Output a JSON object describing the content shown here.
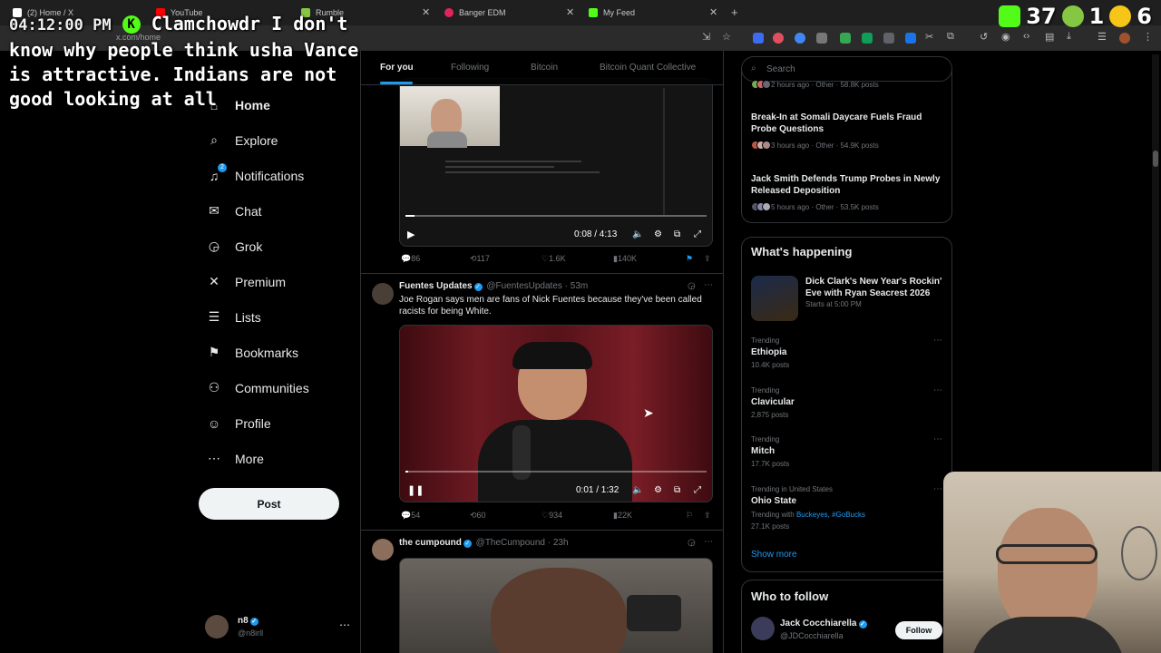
{
  "browser": {
    "tabs": [
      {
        "label": "(2) Home / X",
        "color": "#ffffff"
      },
      {
        "label": "YouTube",
        "color": "#ff0000"
      },
      {
        "label": "Rumble",
        "color": "#85c742"
      },
      {
        "label": "Banger EDM",
        "color": "#e0245e"
      },
      {
        "label": "My Feed",
        "color": "#53fc18"
      }
    ],
    "url": "x.com/home"
  },
  "overlay": {
    "time": "04:12:00 PM",
    "username": "Clamchowdr",
    "message": "I don't know why people think usha Vance is attractive. Indians are not good looking at all",
    "kick_count": "37",
    "rumble_count": "1",
    "other_count": "6",
    "colors": {
      "kick": "#53fc18",
      "rumble": "#85c742",
      "other": "#f5c518"
    }
  },
  "nav": {
    "items": [
      {
        "label": "Home",
        "icon": "home-icon",
        "glyph": "⌂"
      },
      {
        "label": "Explore",
        "icon": "search-icon",
        "glyph": "⌕"
      },
      {
        "label": "Notifications",
        "icon": "bell-icon",
        "glyph": "🔔",
        "badge": "2"
      },
      {
        "label": "Chat",
        "icon": "mail-icon",
        "glyph": "✉"
      },
      {
        "label": "Grok",
        "icon": "grok-icon",
        "glyph": "◶"
      },
      {
        "label": "Premium",
        "icon": "x-logo-icon",
        "glyph": "𝕏"
      },
      {
        "label": "Lists",
        "icon": "list-icon",
        "glyph": "☰"
      },
      {
        "label": "Bookmarks",
        "icon": "bookmark-icon",
        "glyph": "⚑"
      },
      {
        "label": "Communities",
        "icon": "people-icon",
        "glyph": "⚇"
      },
      {
        "label": "Profile",
        "icon": "person-icon",
        "glyph": "☺"
      },
      {
        "label": "More",
        "icon": "more-circle-icon",
        "glyph": "⋯"
      }
    ],
    "post_label": "Post",
    "account": {
      "name": "n8",
      "handle": "@n8irll"
    }
  },
  "feed": {
    "tabs": [
      "For you",
      "Following",
      "Bitcoin",
      "Bitcoin Quant Collective"
    ],
    "tweet1": {
      "video_time": "0:08 / 4:13",
      "video_progress": 0.03,
      "replies": "86",
      "reposts": "117",
      "likes": "1.6K",
      "views": "140K"
    },
    "tweet2": {
      "name": "Fuentes Updates",
      "handle": "@FuentesUpdates",
      "age": "· 53m",
      "text": "Joe Rogan says men are fans of Nick Fuentes because they've been called racists for being White.",
      "video_time": "0:01 / 1:32",
      "video_progress": 0.01,
      "replies": "54",
      "reposts": "60",
      "likes": "934",
      "views": "22K"
    },
    "tweet3": {
      "name": "the cumpound",
      "handle": "@TheCumpound",
      "age": "· 23h"
    }
  },
  "sidebar": {
    "search_placeholder": "Search",
    "news": [
      {
        "title": "",
        "meta": "2 hours ago · Other · 58.8K posts"
      },
      {
        "title": "Break-In at Somali Daycare Fuels Fraud Probe Questions",
        "meta": "3 hours ago · Other · 54.9K posts"
      },
      {
        "title": "Jack Smith Defends Trump Probes in Newly Released Deposition",
        "meta": "5 hours ago · Other · 53.5K posts"
      }
    ],
    "whats_happening": {
      "title": "What's happening",
      "event": {
        "title": "Dick Clark's New Year's Rockin' Eve with Ryan Seacrest 2026",
        "meta": "Starts at 5:00 PM"
      },
      "trends": [
        {
          "category": "Trending",
          "name": "Ethiopia",
          "count": "10.4K posts"
        },
        {
          "category": "Trending",
          "name": "Clavicular",
          "count": "2,875 posts"
        },
        {
          "category": "Trending",
          "name": "Mitch",
          "count": "17.7K posts"
        },
        {
          "category": "Trending in United States",
          "name": "Ohio State",
          "with": "Trending with",
          "tags": "Buckeyes, #GoBucks",
          "count": "27.1K posts"
        }
      ],
      "show_more": "Show more"
    },
    "who_to_follow": {
      "title": "Who to follow",
      "user": {
        "name": "Jack Cocchiarella",
        "handle": "@JDCocchiarella"
      },
      "follow_label": "Follow"
    }
  }
}
